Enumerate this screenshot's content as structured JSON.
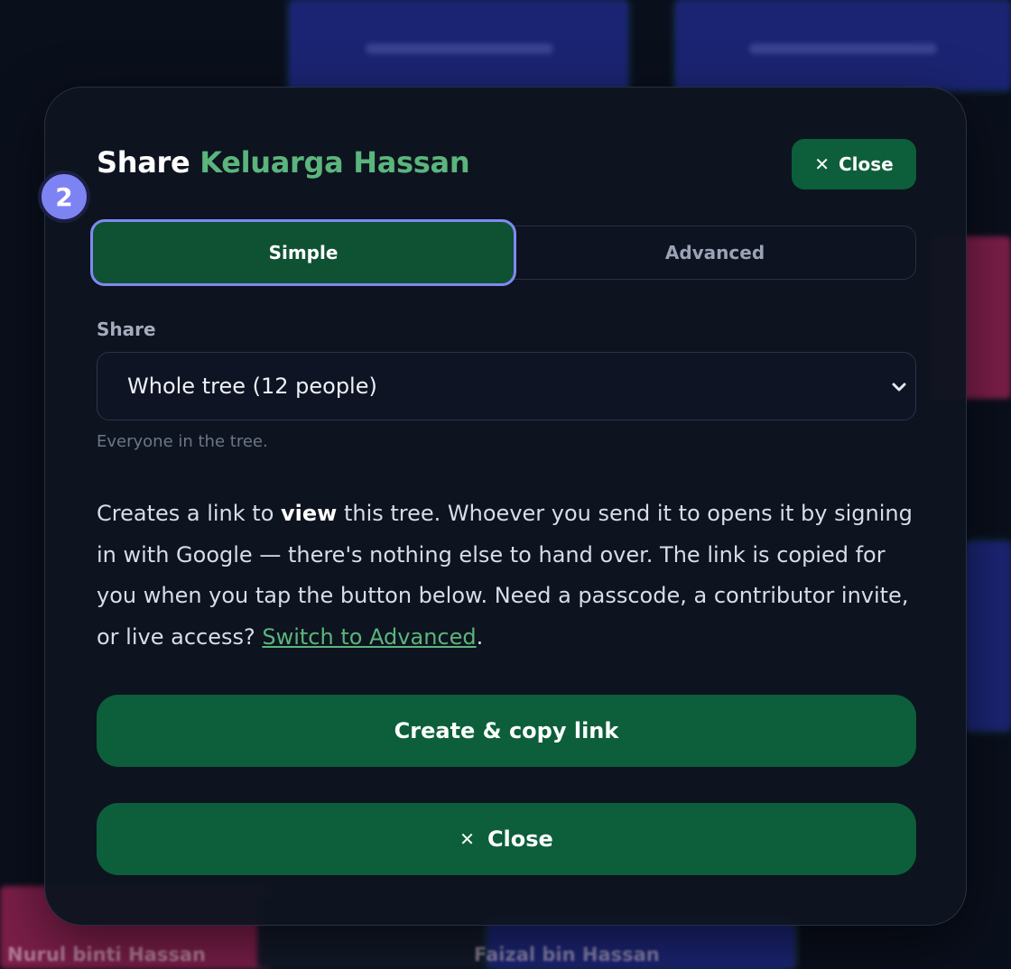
{
  "modal": {
    "title_lead": "Share",
    "tree_name": "Keluarga Hassan",
    "step_badge": "2",
    "close_top_label": "Close",
    "tabs": [
      {
        "label": "Simple",
        "active": true
      },
      {
        "label": "Advanced",
        "active": false
      }
    ],
    "share_label": "Share",
    "share_select": {
      "selected": "Whole tree (12 people)"
    },
    "hint": "Everyone in the tree.",
    "description": {
      "part1": "Creates a link to ",
      "bold": "view",
      "part2": " this tree. Whoever you send it to opens it by signing in with Google — there's nothing else to hand over. The link is copied for you when you tap the button below. Need a passcode, a contributor invite, or live access? ",
      "link": "Switch to Advanced",
      "end": "."
    },
    "create_button_label": "Create & copy link",
    "close_bottom_label": "Close"
  },
  "background": {
    "person_names": [
      "Nurul binti Hassan",
      "Faizal bin Hassan"
    ]
  },
  "colors": {
    "accent_green": "#0c5f3a",
    "name_green": "#5bb57c",
    "badge_purple": "#7e83f3",
    "modal_bg": "#0e1420"
  }
}
